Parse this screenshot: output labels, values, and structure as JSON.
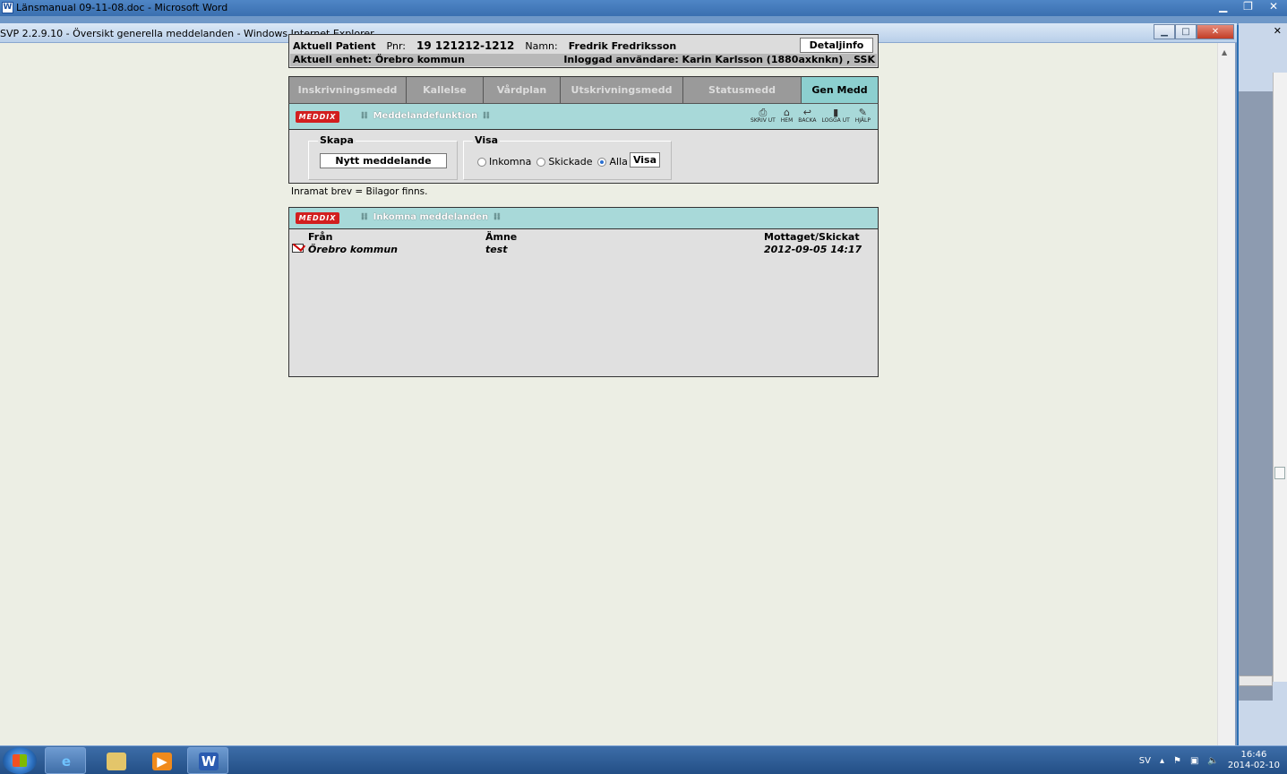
{
  "word_window": {
    "title": "Länsmanual 09-11-08.doc - Microsoft Word",
    "icon": "word-doc-icon",
    "controls": {
      "minimize": "▁",
      "restore": "❐",
      "close": "✕"
    }
  },
  "ie_window": {
    "title": "SVP 2.2.9.10 - Översikt generella meddelanden - Windows Internet Explorer",
    "controls": {
      "minimize": "▁",
      "maximize": "□",
      "close": "✕"
    }
  },
  "patient": {
    "label": "Aktuell Patient",
    "pnr_label": "Pnr:",
    "pnr_value": "19 121212-1212",
    "name_label": "Namn:",
    "name_value": "Fredrik Fredriksson",
    "detail_button": "Detaljinfo",
    "unit": "Aktuell enhet: Örebro kommun",
    "user": "Inloggad användare: Karin Karlsson (1880axknkn) , SSK"
  },
  "tabs": [
    {
      "label": "Inskrivningsmedd",
      "active": false
    },
    {
      "label": "Kallelse",
      "active": false
    },
    {
      "label": "Vårdplan",
      "active": false
    },
    {
      "label": "Utskrivningsmedd",
      "active": false
    },
    {
      "label": "Statusmedd",
      "active": false
    },
    {
      "label": "Gen Medd",
      "active": true
    }
  ],
  "func_section": {
    "logo": "MEDDIX",
    "title": "Meddelandefunktion",
    "icons": [
      {
        "name": "printer-icon",
        "glyph": "⎙",
        "label": "SKRIV UT"
      },
      {
        "name": "home-icon",
        "glyph": "⌂",
        "label": "HEM"
      },
      {
        "name": "back-icon",
        "glyph": "↩",
        "label": "BACKA"
      },
      {
        "name": "logout-icon",
        "glyph": "▮",
        "label": "LOGGA UT"
      },
      {
        "name": "help-icon",
        "glyph": "✎",
        "label": "HJÄLP"
      }
    ]
  },
  "create": {
    "group_label": "Skapa",
    "new_button": "Nytt meddelande"
  },
  "view": {
    "group_label": "Visa",
    "options": [
      {
        "label": "Inkomna",
        "selected": false
      },
      {
        "label": "Skickade",
        "selected": false
      },
      {
        "label": "Alla",
        "selected": true
      }
    ],
    "button": "Visa"
  },
  "note": "Inramat brev = Bilagor finns.",
  "inbox": {
    "logo": "MEDDIX",
    "title": "Inkomna meddelanden",
    "columns": {
      "from": "Från",
      "subject": "Ämne",
      "date": "Mottaget/Skickat"
    },
    "rows": [
      {
        "from": "Örebro kommun",
        "subject": "test",
        "date": "2012-09-05 14:17"
      }
    ]
  },
  "taskbar": {
    "lang": "SV",
    "time": "16:46",
    "date": "2014-02-10"
  },
  "colors": {
    "teal_header": "#a8d9d9",
    "active_tab": "#8ccfcf",
    "tab_grey": "#9a9a9a",
    "logo_red": "#d21f1f",
    "page_bg": "#eceee4"
  }
}
